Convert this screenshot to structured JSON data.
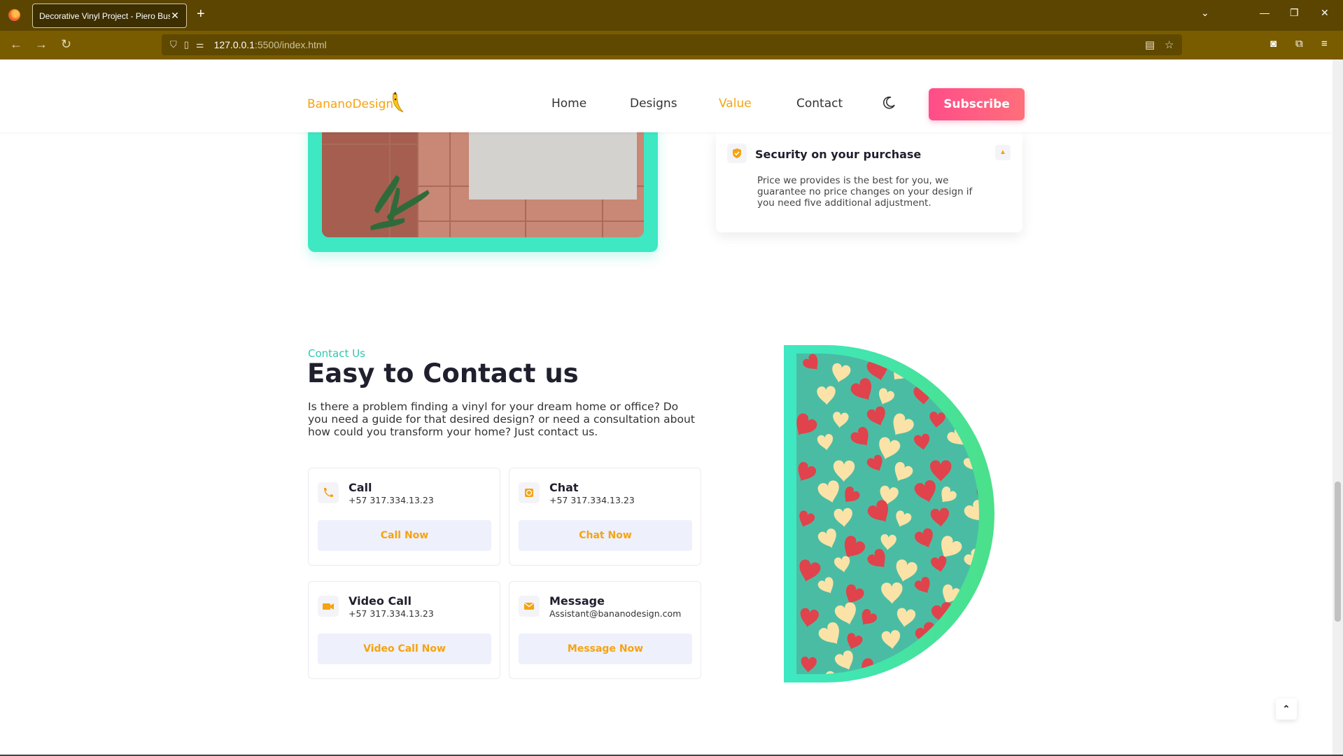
{
  "browser": {
    "tab_title": "Decorative Vinyl Project - Piero Bust",
    "tab_close": "✕",
    "new_tab": "+",
    "url_host": "127.0.0.1",
    "url_path": ":5500/index.html"
  },
  "header": {
    "logo_text": "BananoDesign",
    "menu": [
      {
        "label": "Home",
        "active": false
      },
      {
        "label": "Designs",
        "active": false
      },
      {
        "label": "Value",
        "active": true
      },
      {
        "label": "Contact",
        "active": false
      }
    ],
    "subscribe_label": "Subscribe"
  },
  "value": {
    "accordion_title": "Security on your purchase",
    "accordion_text": "Price we provides is the best for you, we guarantee no price changes on your design if you need five additional adjustment."
  },
  "contact": {
    "subtitle": "Contact Us",
    "title": "Easy to Contact us",
    "description": "Is there a problem finding a vinyl for your dream home or office? Do you need a guide for that desired design? or need a consultation about how could you transform your home? Just contact us.",
    "cards": [
      {
        "title": "Call",
        "detail": "+57 317.334.13.23",
        "button": "Call Now",
        "icon": "phone-icon"
      },
      {
        "title": "Chat",
        "detail": "+57 317.334.13.23",
        "button": "Chat Now",
        "icon": "chat-icon"
      },
      {
        "title": "Video Call",
        "detail": "+57 317.334.13.23",
        "button": "Video Call Now",
        "icon": "video-icon"
      },
      {
        "title": "Message",
        "detail": "Assistant@bananodesign.com",
        "button": "Message Now",
        "icon": "mail-icon"
      }
    ]
  },
  "colors": {
    "accent": "#f5a30f",
    "teal": "#3de8c3",
    "subscribe": "#ff4d8a",
    "browser_bar": "#5c4500"
  }
}
